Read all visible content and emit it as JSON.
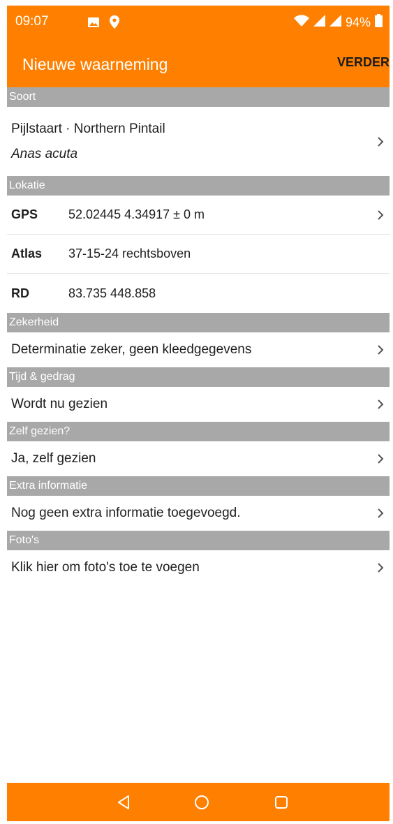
{
  "status_bar": {
    "time": "09:07",
    "battery": "94%",
    "icons": [
      "image-icon",
      "location-pin-icon",
      "wifi-icon",
      "signal-icon",
      "signal-icon",
      "battery-icon"
    ]
  },
  "app_bar": {
    "title": "Nieuwe waarneming",
    "action_label": "VERDER"
  },
  "colors": {
    "primary": "#ff8000",
    "section_header": "#a8a8a8"
  },
  "sections": {
    "soort": {
      "header": "Soort",
      "name": "Pijlstaart · Northern Pintail",
      "latin": "Anas acuta"
    },
    "lokatie": {
      "header": "Lokatie",
      "rows": [
        {
          "label": "GPS",
          "value": "52.02445 4.34917 ± 0 m"
        },
        {
          "label": "Atlas",
          "value": "37-15-24 rechtsboven"
        },
        {
          "label": "RD",
          "value": "83.735 448.858"
        }
      ]
    },
    "zekerheid": {
      "header": "Zekerheid",
      "value": "Determinatie zeker, geen kleedgegevens"
    },
    "tijd_gedrag": {
      "header": "Tijd & gedrag",
      "value": "Wordt nu gezien"
    },
    "zelf_gezien": {
      "header": "Zelf gezien?",
      "value": "Ja, zelf gezien"
    },
    "extra_informatie": {
      "header": "Extra informatie",
      "value": "Nog geen extra informatie toegevoegd."
    },
    "fotos": {
      "header": "Foto's",
      "value": "Klik hier om foto's toe te voegen"
    }
  },
  "nav_bar": {
    "icons": [
      "back-triangle-icon",
      "home-circle-icon",
      "recents-square-icon"
    ]
  }
}
